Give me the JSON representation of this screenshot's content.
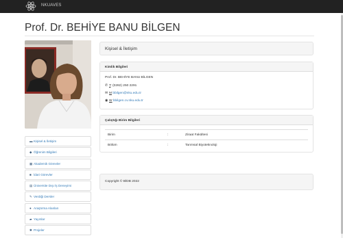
{
  "topbar": {
    "brand": "NKUAVES",
    "logo_icon": "atom-icon"
  },
  "page_title": "Prof. Dr. BEHİYE BANU BİLGEN",
  "nav": [
    {
      "icon": "university-icon",
      "label": "Kişisel & İletişim"
    },
    {
      "icon": "graduation-cap-icon",
      "label": "Öğrenim Bilgileri"
    },
    {
      "icon": "calendar-icon",
      "label": "Akademik Görevler"
    },
    {
      "icon": "briefcase-icon",
      "label": "İdari Görevler"
    },
    {
      "icon": "bank-icon",
      "label": "Üniversite Dışı İş Deneyimi"
    },
    {
      "icon": "pencil-icon",
      "label": "Verdiği Dersler"
    },
    {
      "icon": "users-icon",
      "label": "Araştırma Alanları"
    },
    {
      "icon": "book-icon",
      "label": "Yayınlar"
    },
    {
      "icon": "cogs-icon",
      "label": "Projeler"
    }
  ],
  "section_title": "Kişisel & İletişim",
  "kimlik": {
    "heading": "Kimlik Bilgileri",
    "name": "Prof. Dr. BEHİYE BANU BİLGEN",
    "phone_prefix": "T",
    "phone": ": (0282) 250 2291",
    "email_prefix": "M",
    "email": "bbilgen@nku.edu.tr",
    "web_prefix": "W",
    "web": "bbilgen.cv.nku.edu.tr"
  },
  "birim": {
    "heading": "Çalıştığı Birim Bilgileri",
    "rows": [
      {
        "label": "Birim",
        "colon": ":",
        "value": "Ziraat Fakültesi"
      },
      {
        "label": "Bölüm",
        "colon": ":",
        "value": "Tarımsal Biyoteknoloji"
      }
    ]
  },
  "footer": {
    "copyright": "Copyright © BİDB 2022"
  },
  "colors": {
    "topbar": "#222222",
    "link": "#337ab7",
    "panel_heading": "#f5f5f5",
    "border": "#dddddd"
  }
}
